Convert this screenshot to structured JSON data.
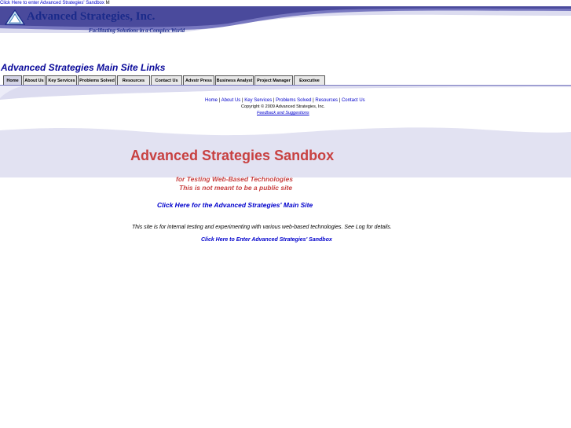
{
  "top_bar": {
    "link_text": "Click Here to enter Advanced Strategies' Sandbox",
    "suffix": "M"
  },
  "banner": {
    "logo_text": "Advanced Strategies, Inc.",
    "tagline": "Facilitating Solutions in a Complex World"
  },
  "section_title": "Advanced Strategies Main Site Links",
  "tabs": [
    {
      "label": "Home",
      "active": true
    },
    {
      "label": "About Us"
    },
    {
      "label": "Key Services"
    },
    {
      "label": "Problems Solved"
    },
    {
      "label": "Resources"
    },
    {
      "label": "Contact Us"
    },
    {
      "label": "Advstr Press"
    },
    {
      "label": "Business Analyst"
    },
    {
      "label": "Project Manager"
    },
    {
      "label": "Executive"
    }
  ],
  "footer": {
    "links": [
      "Home",
      "About Us",
      "Key Services",
      "Problems Solved",
      "Resources",
      "Contact Us"
    ],
    "separator": "|",
    "copyright": "Copyright © 2009 Advanced Strategies, Inc.",
    "feedback": "Feedback and Suggestions"
  },
  "hero": {
    "title": "Advanced Strategies Sandbox",
    "subtitle_1": "for Testing Web-Based Technologies",
    "subtitle_2": "This is not meant to be a public site",
    "main_site_link": "Click Here for the Advanced Strategies' Main Site",
    "info": "This site is for internal testing and experimenting with various web-based technologies.  See Log for details.",
    "sandbox_link": "Click Here to Enter Advanced Strategies' Sandbox"
  },
  "colors": {
    "brand_navy": "#1a2a8a",
    "link_blue": "#0000cc",
    "hero_red": "#c84141",
    "wave_lavender": "#dcdcf0",
    "wave_purple": "#5a5aa8"
  }
}
